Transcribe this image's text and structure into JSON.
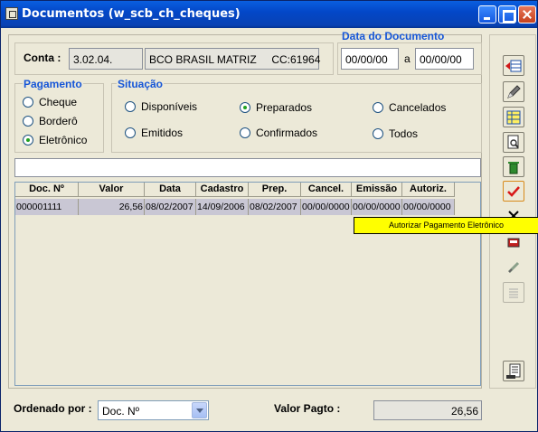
{
  "window": {
    "title": "Documentos (w_scb_ch_cheques)"
  },
  "conta": {
    "label": "Conta :",
    "code": "3.02.04.",
    "bank": "BCO BRASIL MATRIZ     CC:61964"
  },
  "data_documento": {
    "label": "Data do Documento",
    "from": "00/00/00",
    "sep": "a",
    "to": "00/00/00"
  },
  "pagamento": {
    "label": "Pagamento",
    "options": [
      "Cheque",
      "Borderô",
      "Eletrônico"
    ],
    "selected": "Eletrônico"
  },
  "situacao": {
    "label": "Situação",
    "options": {
      "disponiveis": "Disponíveis",
      "preparados": "Preparados",
      "cancelados": "Cancelados",
      "emitidos": "Emitidos",
      "confirmados": "Confirmados",
      "todos": "Todos"
    },
    "selected": "Preparados"
  },
  "search": {
    "value": ""
  },
  "table": {
    "columns": [
      "Doc. Nº",
      "Valor",
      "Data",
      "Cadastro",
      "Prep.",
      "Cancel.",
      "Emissão",
      "Autoriz."
    ],
    "rows": [
      [
        "000001111",
        "26,56",
        "08/02/2007",
        "14/09/2006",
        "08/02/2007",
        "00/00/0000",
        "00/00/0000",
        "00/00/0000"
      ]
    ]
  },
  "tooltip": {
    "text": "Autorizar Pagamento Eletrônico"
  },
  "toolbar": {
    "buttons": [
      "insert-row-icon",
      "edit-pencil-icon",
      "grid-select-icon",
      "print-preview-icon",
      "trash-icon",
      "check-mark-icon",
      "close-x-icon",
      "authorize-icon",
      "confirm-icon",
      "list-icon",
      "report-icon"
    ]
  },
  "footer": {
    "ordenado_label": "Ordenado por :",
    "ordenado_value": "Doc. Nº",
    "valor_label": "Valor Pagto :",
    "valor_value": "26,56"
  }
}
